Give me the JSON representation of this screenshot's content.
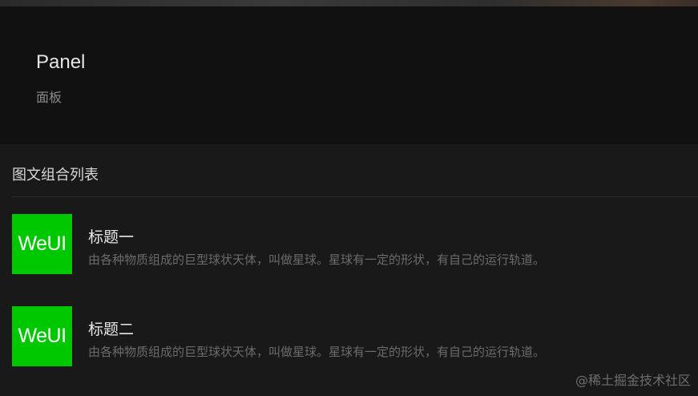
{
  "page": {
    "title": "Panel",
    "desc": "面板"
  },
  "panel": {
    "header": "图文组合列表",
    "items": [
      {
        "thumb_text": "WeUI",
        "title": "标题一",
        "desc": "由各种物质组成的巨型球状天体，叫做星球。星球有一定的形状，有自己的运行轨道。"
      },
      {
        "thumb_text": "WeUI",
        "title": "标题二",
        "desc": "由各种物质组成的巨型球状天体，叫做星球。星球有一定的形状，有自己的运行轨道。"
      }
    ]
  },
  "watermark": "@稀土掘金技术社区",
  "colors": {
    "background": "#111111",
    "panel_background": "#191919",
    "thumb_green": "#00c800",
    "divider": "#2f2f2f"
  }
}
